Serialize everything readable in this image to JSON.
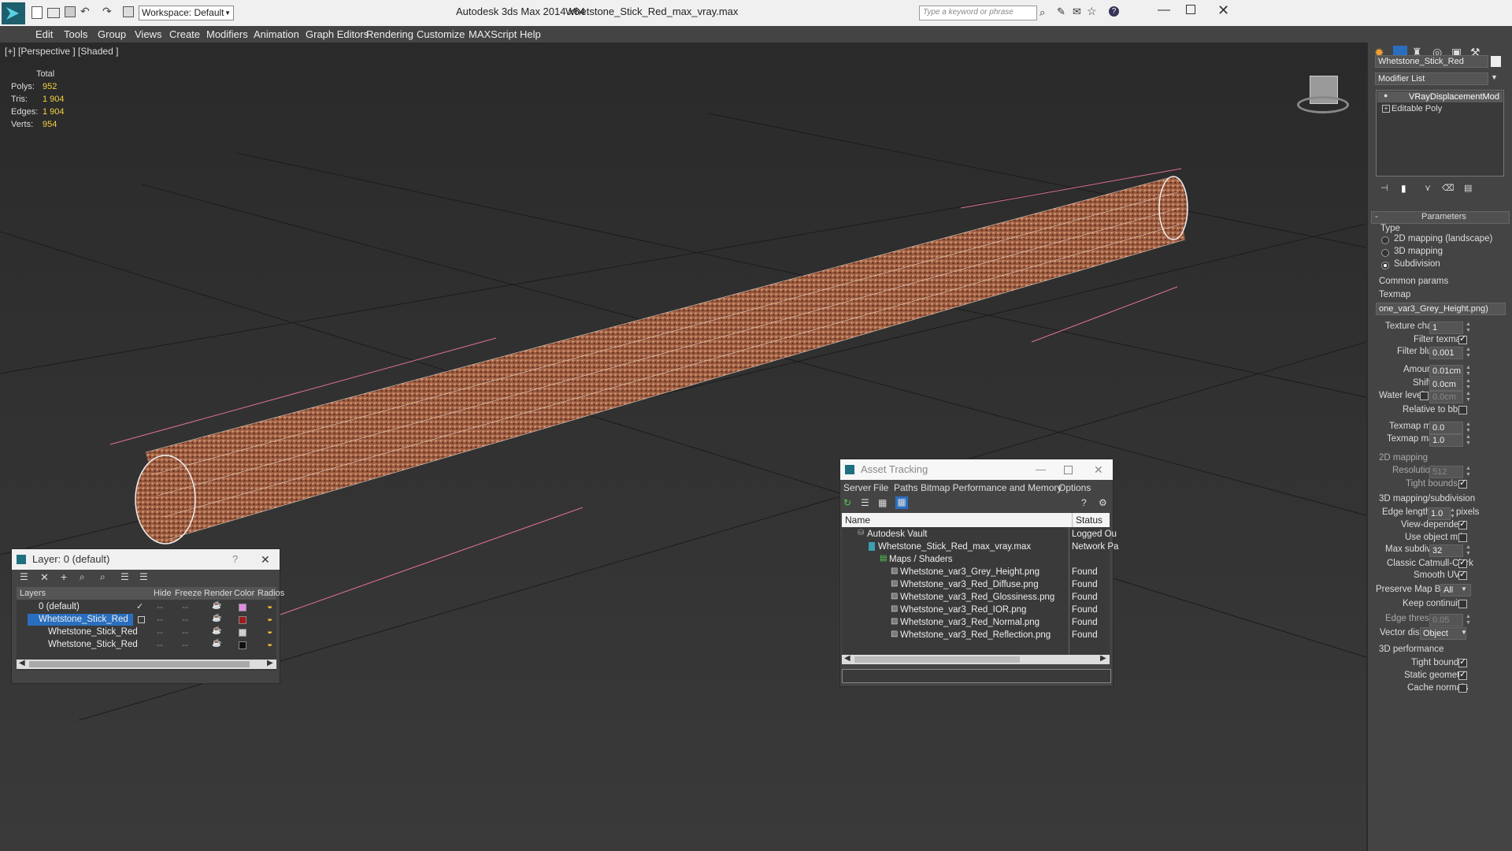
{
  "app": {
    "title": "Autodesk 3ds Max  2014 x64",
    "filename": "Whetstone_Stick_Red_max_vray.max",
    "workspace": "Workspace: Default",
    "search_placeholder": "Type a keyword or phrase"
  },
  "menu": [
    "Edit",
    "Tools",
    "Group",
    "Views",
    "Create",
    "Modifiers",
    "Animation",
    "Graph Editors",
    "Rendering",
    "Customize",
    "MAXScript",
    "Help"
  ],
  "viewport": {
    "label": "[+] [Perspective ] [Shaded ]",
    "stats": {
      "header": "Total",
      "rows": [
        {
          "label": "Polys:",
          "value": "952"
        },
        {
          "label": "Tris:",
          "value": "1 904"
        },
        {
          "label": "Edges:",
          "value": "1 904"
        },
        {
          "label": "Verts:",
          "value": "954"
        }
      ]
    }
  },
  "command_panel": {
    "object_name": "Whetstone_Stick_Red",
    "modifier_list": "Modifier List",
    "stack": [
      "VRayDisplacementMod",
      "Editable Poly"
    ],
    "rollout_title": "Parameters",
    "type_label": "Type",
    "type_options": [
      "2D mapping (landscape)",
      "3D mapping",
      "Subdivision"
    ],
    "common_params": "Common params",
    "texmap_label": "Texmap",
    "texmap_value": "one_var3_Grey_Height.png)",
    "texture_chan_label": "Texture chan",
    "texture_chan_value": "1",
    "filter_texmap": "Filter texmap",
    "filter_blur_label": "Filter blur",
    "filter_blur_value": "0.001",
    "amount_label": "Amount",
    "amount_value": "0.01cm",
    "shift_label": "Shift",
    "shift_value": "0.0cm",
    "water_level_label": "Water level",
    "water_level_value": "0.0cm",
    "relative_bbox": "Relative to bbox",
    "texmap_min_label": "Texmap min",
    "texmap_min_value": "0.0",
    "texmap_max_label": "Texmap max",
    "texmap_max_value": "1.0",
    "mapping2d": "2D mapping",
    "resolution_label": "Resolution",
    "resolution_value": "512",
    "tight_bounds": "Tight bounds",
    "mapping3d": "3D mapping/subdivision",
    "edge_length_label": "Edge length",
    "edge_length_value": "1.0",
    "pixels": "pixels",
    "view_dependent": "View-dependent",
    "use_object_mtl": "Use object mtl",
    "max_subdivs_label": "Max subdivs",
    "max_subdivs_value": "32",
    "classic_catmull": "Classic Catmull-Clark",
    "smooth_uvs": "Smooth UVs",
    "preserve_map_label": "Preserve Map Bnd",
    "preserve_map_value": "All",
    "keep_continuity": "Keep continuity",
    "edge_thresh_label": "Edge thresh",
    "edge_thresh_value": "0.05",
    "vector_displ_label": "Vector displ",
    "vector_displ_value": "Object",
    "perf": "3D performance",
    "perf_tight_bounds": "Tight bounds",
    "static_geometry": "Static geometry",
    "cache_normals": "Cache normals"
  },
  "layer_window": {
    "title": "Layer: 0 (default)",
    "help": "?",
    "columns": [
      "Layers",
      "Hide",
      "Freeze",
      "Render",
      "Color",
      "Radios"
    ],
    "rows": [
      {
        "name": "0 (default)",
        "color": "#e38ce3"
      },
      {
        "name": "Whetstone_Stick_Red",
        "color": "#a01a1a"
      },
      {
        "name": "Whetstone_Stick_Red",
        "color": "#d0d0d0"
      },
      {
        "name": "Whetstone_Stick_Red",
        "color": "#111111"
      }
    ]
  },
  "asset_window": {
    "title": "Asset Tracking",
    "menu": [
      "Server",
      "File",
      "Paths",
      "Bitmap Performance and Memory",
      "Options"
    ],
    "columns": [
      "Name",
      "Status"
    ],
    "rows": [
      {
        "name": "Autodesk Vault",
        "status": "Logged Ou"
      },
      {
        "name": "Whetstone_Stick_Red_max_vray.max",
        "status": "Network Pa"
      },
      {
        "name": "Maps / Shaders",
        "status": ""
      },
      {
        "name": "Whetstone_var3_Grey_Height.png",
        "status": "Found"
      },
      {
        "name": "Whetstone_var3_Red_Diffuse.png",
        "status": "Found"
      },
      {
        "name": "Whetstone_var3_Red_Glossiness.png",
        "status": "Found"
      },
      {
        "name": "Whetstone_var3_Red_IOR.png",
        "status": "Found"
      },
      {
        "name": "Whetstone_var3_Red_Normal.png",
        "status": "Found"
      },
      {
        "name": "Whetstone_var3_Red_Reflection.png",
        "status": "Found"
      }
    ]
  }
}
